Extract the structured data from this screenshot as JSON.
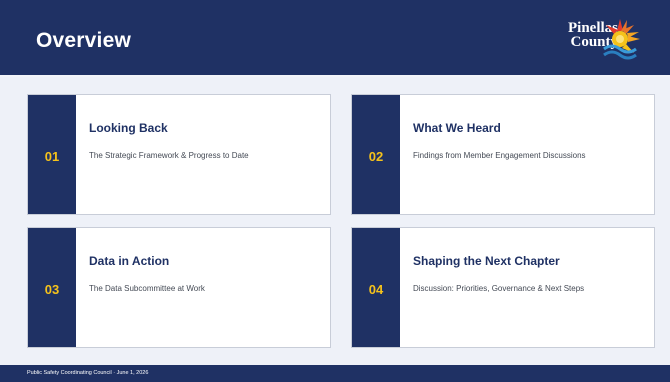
{
  "header": {
    "title": "Overview",
    "logo": {
      "line1": "Pinellas",
      "line2": "County",
      "icon": "sun-logo-icon"
    }
  },
  "cards": [
    {
      "number": "01",
      "title": "Looking Back",
      "description": "The Strategic Framework & Progress to Date"
    },
    {
      "number": "02",
      "title": "What We Heard",
      "description": "Findings from Member Engagement Discussions"
    },
    {
      "number": "03",
      "title": "Data in Action",
      "description": "The Data Subcommittee at Work"
    },
    {
      "number": "04",
      "title": "Shaping the Next Chapter",
      "description": "Discussion: Priorities, Governance & Next Steps"
    }
  ],
  "footer": {
    "text": "Public Safety Coordinating Council  ·  June 1, 2026"
  },
  "colors": {
    "navy": "#1f3164",
    "accent_yellow": "#f5c21b",
    "background": "#eef1f8"
  }
}
